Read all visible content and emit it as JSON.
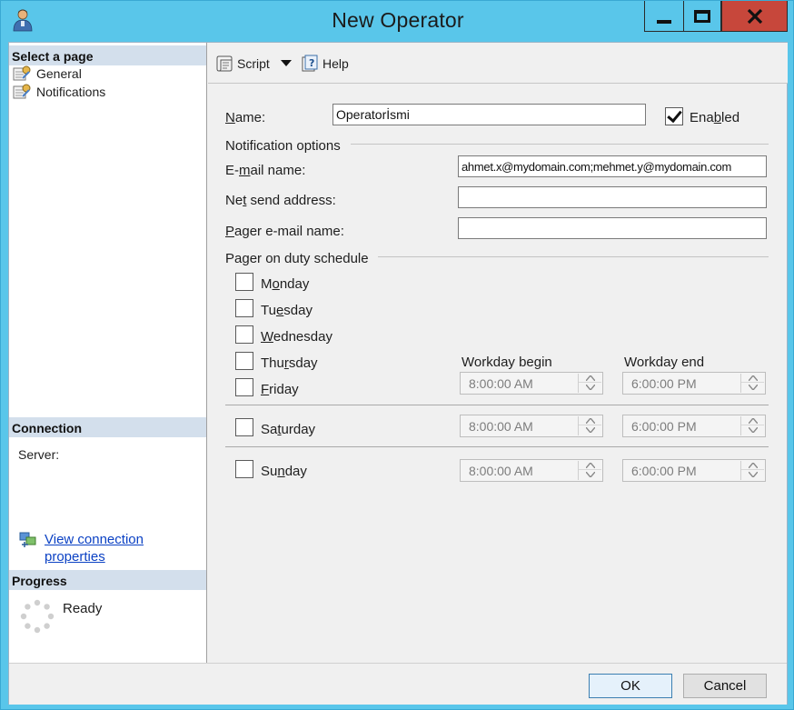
{
  "window": {
    "title": "New Operator"
  },
  "left_pane": {
    "select_header": "Select a page",
    "pages": [
      {
        "label": "General"
      },
      {
        "label": "Notifications"
      }
    ],
    "connection_header": "Connection",
    "server_label": "Server:",
    "view_connection_line1": "View connection",
    "view_connection_line2": "properties",
    "progress_header": "Progress",
    "progress_status": "Ready"
  },
  "toolbar": {
    "script_label": "Script",
    "help_label": "Help"
  },
  "general": {
    "name_label": "Name:",
    "name_value": "Operatorİsmi",
    "enabled_label": "Enabled",
    "enabled_checked": true,
    "notification_group": "Notification options",
    "email_label": "E-mail name:",
    "email_value": "ahmet.x@mydomain.com;mehmet.y@mydomain.com",
    "netsend_label": "Net send address:",
    "netsend_value": "",
    "pager_label": "Pager e-mail name:",
    "pager_value": "",
    "schedule_group": "Pager on duty schedule",
    "days": [
      {
        "label": "Monday",
        "checked": false
      },
      {
        "label": "Tuesday",
        "checked": false
      },
      {
        "label": "Wednesday",
        "checked": false
      },
      {
        "label": "Thursday",
        "checked": false
      },
      {
        "label": "Friday",
        "checked": false
      },
      {
        "label": "Saturday",
        "checked": false
      },
      {
        "label": "Sunday",
        "checked": false
      }
    ],
    "workday_begin_label": "Workday begin",
    "workday_end_label": "Workday end",
    "times": {
      "weekday_begin": "8:00:00 AM",
      "weekday_end": "6:00:00 PM",
      "saturday_begin": "8:00:00 AM",
      "saturday_end": "6:00:00 PM",
      "sunday_begin": "8:00:00 AM",
      "sunday_end": "6:00:00 PM"
    }
  },
  "buttons": {
    "ok": "OK",
    "cancel": "Cancel"
  }
}
